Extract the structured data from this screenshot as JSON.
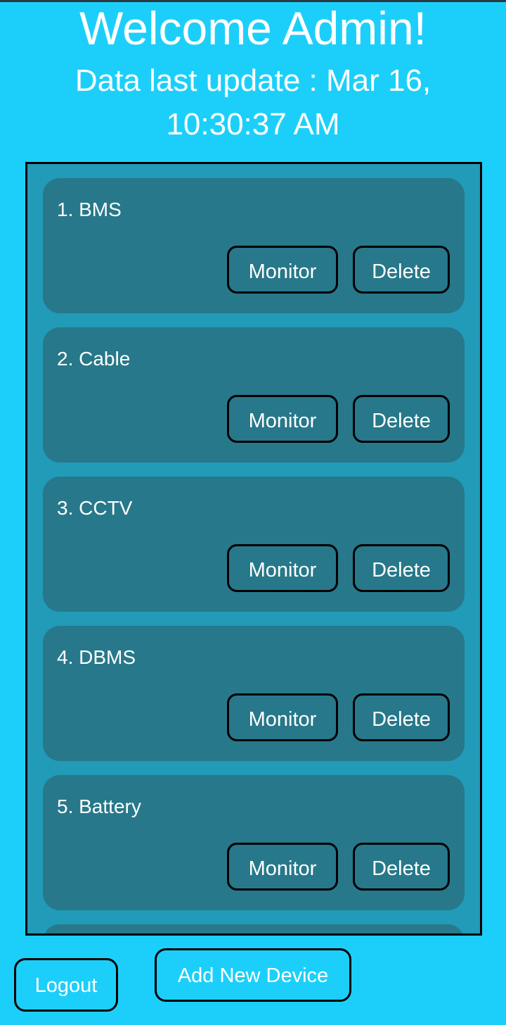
{
  "header": {
    "title": "Welcome Admin!",
    "subtitle": "Data last update : Mar 16, 10:30:37 AM"
  },
  "devices": [
    {
      "name": "1. BMS",
      "monitor_label": "Monitor",
      "delete_label": "Delete"
    },
    {
      "name": "2. Cable",
      "monitor_label": "Monitor",
      "delete_label": "Delete"
    },
    {
      "name": "3. CCTV",
      "monitor_label": "Monitor",
      "delete_label": "Delete"
    },
    {
      "name": "4. DBMS",
      "monitor_label": "Monitor",
      "delete_label": "Delete"
    },
    {
      "name": "5. Battery",
      "monitor_label": "Monitor",
      "delete_label": "Delete"
    }
  ],
  "footer": {
    "logout_label": "Logout",
    "add_device_label": "Add New Device"
  },
  "colors": {
    "background": "#1ccffa",
    "panel": "#219bb7",
    "card": "#27788a",
    "text": "#ffffff",
    "border": "#000000"
  }
}
